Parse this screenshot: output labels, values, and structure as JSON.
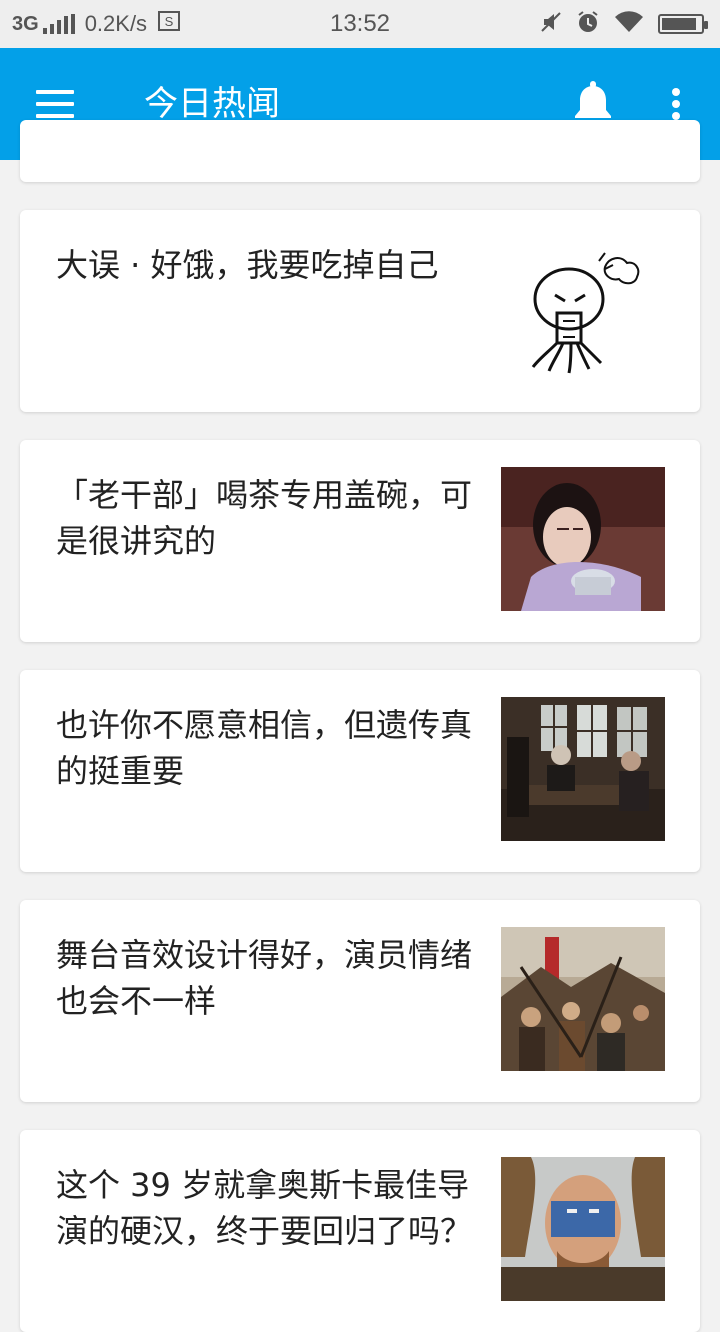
{
  "status_bar": {
    "network": "3G",
    "speed": "0.2K/s",
    "time": "13:52",
    "battery_level": 0.9
  },
  "app_bar": {
    "title": "今日热闻",
    "color": "#03a0e8",
    "menu_icon": "hamburger-menu-icon",
    "notification_icon": "bell-icon",
    "overflow_icon": "more-vert-icon"
  },
  "stories": [
    {
      "title": "大误 · 好饿，我要吃掉自己",
      "image": "cartoon-ghost-doodle"
    },
    {
      "title": "「老干部」喝茶专用盖碗，可是很讲究的",
      "image": "woman-holding-tea-bowl"
    },
    {
      "title": "也许你不愿意相信，但遗传真的挺重要",
      "image": "men-at-table-in-hall"
    },
    {
      "title": "舞台音效设计得好，演员情绪也会不一样",
      "image": "stage-musical-crowd"
    },
    {
      "title": "这个 39 岁就拿奥斯卡最佳导演的硬汉，终于要回归了吗？",
      "image": "face-painted-warrior"
    }
  ]
}
